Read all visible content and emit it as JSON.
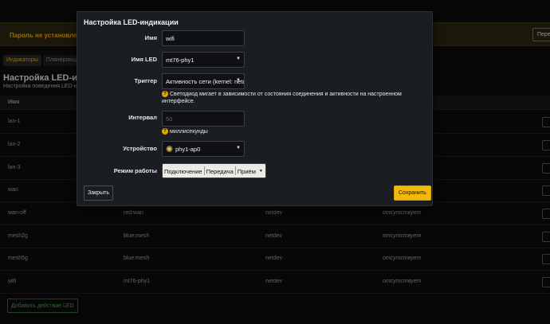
{
  "warning": {
    "text": "Пароль не установлен!",
    "button": "Пере"
  },
  "tabs": [
    "Индикаторы",
    "Планировщ"
  ],
  "page": {
    "title": "Настройка LED-инди",
    "description": "Настройка поведения LED-и"
  },
  "table": {
    "header": "Имя",
    "rows": [
      {
        "name": "lan-1",
        "led": "",
        "trigger": "",
        "value": ""
      },
      {
        "name": "lan-2",
        "led": "",
        "trigger": "",
        "value": ""
      },
      {
        "name": "lan-3",
        "led": "",
        "trigger": "",
        "value": ""
      },
      {
        "name": "wan",
        "led": "",
        "trigger": "",
        "value": ""
      },
      {
        "name": "wan-off",
        "led": "red:wan",
        "trigger": "netdev",
        "value": "отсутствует"
      },
      {
        "name": "mesh2g",
        "led": "blue:mesh",
        "trigger": "netdev",
        "value": "отсутствует"
      },
      {
        "name": "mesh5g",
        "led": "blue:mesh",
        "trigger": "netdev",
        "value": "отсутствует"
      },
      {
        "name": "wifi",
        "led": "mt76-phy1",
        "trigger": "netdev",
        "value": "отсутствует"
      }
    ],
    "add_button": "Добавить действие LED"
  },
  "modal": {
    "title": "Настройка LED-индикации",
    "name_label": "Имя",
    "name_value": "wifi",
    "led_label": "Имя LED",
    "led_value": "mt76-phy1",
    "trigger_label": "Триггер",
    "trigger_value": "Активность сети (kernel: netdev)",
    "trigger_help": "Светодиод мигает в зависимости от состояния соединения и активности на настроенном интерфейсе.",
    "interval_label": "Интервал",
    "interval_placeholder": "50",
    "interval_help": "миллисекунды",
    "device_label": "Устройство",
    "device_value": "phy1-ap0",
    "mode_label": "Режим работы",
    "mode_options": [
      "Подключение",
      "Передача",
      "Приём"
    ],
    "close_button": "Закрыть",
    "save_button": "Сохранить"
  },
  "colors": {
    "accent": "#f2b90c",
    "warning": "#e0a800",
    "add": "#3fa33f"
  }
}
